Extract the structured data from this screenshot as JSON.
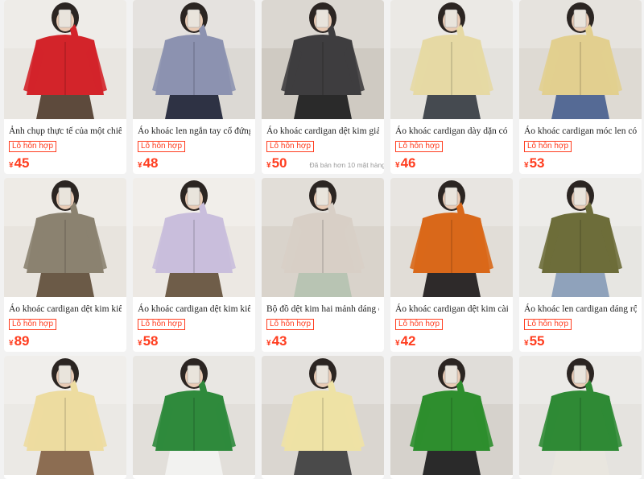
{
  "products": [
    {
      "title": "Ảnh chụp thực tế của một chiếc áo",
      "badge": "Lô hỗn hợp",
      "currency": "¥",
      "price": "45",
      "sold": "",
      "colors": {
        "bg": "#e9e6e1",
        "garment": "#d3242a",
        "pants": "#5d4a3c"
      }
    },
    {
      "title": "Áo khoác len ngắn tay cổ đứng, khóa",
      "badge": "Lô hỗn hợp",
      "currency": "¥",
      "price": "48",
      "sold": "",
      "colors": {
        "bg": "#dcd9d4",
        "garment": "#8c92b0",
        "pants": "#2e3244"
      }
    },
    {
      "title": "Áo khoác cardigan dệt kim giả lông",
      "badge": "Lô hỗn hợp",
      "currency": "¥",
      "price": "50",
      "sold": "Đã bán hơn 10 mặt hàng.",
      "colors": {
        "bg": "#cfcac2",
        "garment": "#3e3d3f",
        "pants": "#2a2a2a"
      }
    },
    {
      "title": "Áo khoác cardigan dày dặn có mũ,",
      "badge": "Lô hỗn hợp",
      "currency": "¥",
      "price": "46",
      "sold": "",
      "colors": {
        "bg": "#e4e2dd",
        "garment": "#e6d9a4",
        "pants": "#454a50"
      }
    },
    {
      "title": "Áo khoác cardigan móc len có mũ",
      "badge": "Lô hỗn hợp",
      "currency": "¥",
      "price": "53",
      "sold": "",
      "colors": {
        "bg": "#dedad3",
        "garment": "#e2cf8f",
        "pants": "#556a95"
      }
    },
    {
      "title": "Áo khoác cardigan dệt kim kiểu Anh,",
      "badge": "Lô hỗn hợp",
      "currency": "¥",
      "price": "89",
      "sold": "",
      "colors": {
        "bg": "#e8e4de",
        "garment": "#8b8270",
        "pants": "#6b5a47"
      }
    },
    {
      "title": "Áo khoác cardigan dệt kim kiểu cáp",
      "badge": "Lô hỗn hợp",
      "currency": "¥",
      "price": "58",
      "sold": "",
      "colors": {
        "bg": "#ece8e3",
        "garment": "#c9bedc",
        "pants": "#6f5d49"
      }
    },
    {
      "title": "Bộ đồ dệt kim hai mảnh dáng ôm",
      "badge": "Lô hỗn hợp",
      "currency": "¥",
      "price": "43",
      "sold": "",
      "colors": {
        "bg": "#d9d3cb",
        "garment": "#d8cfc6",
        "pants": "#b8c4b3"
      }
    },
    {
      "title": "Áo khoác cardigan dệt kim cài khuy",
      "badge": "Lô hỗn hợp",
      "currency": "¥",
      "price": "42",
      "sold": "",
      "colors": {
        "bg": "#e1ddd7",
        "garment": "#d9681a",
        "pants": "#2e2a2a"
      }
    },
    {
      "title": "Áo khoác len cardigan dáng rộng",
      "badge": "Lô hỗn hợp",
      "currency": "¥",
      "price": "55",
      "sold": "",
      "colors": {
        "bg": "#e7e6e2",
        "garment": "#6d6d3a",
        "pants": "#8fa2bb"
      }
    },
    {
      "title": "",
      "badge": "",
      "currency": "",
      "price": "",
      "sold": "",
      "colors": {
        "bg": "#ebe9e5",
        "garment": "#eddca0",
        "pants": "#8c6d52"
      }
    },
    {
      "title": "",
      "badge": "",
      "currency": "",
      "price": "",
      "sold": "",
      "colors": {
        "bg": "#e2dfda",
        "garment": "#2f8a3c",
        "pants": "#f2f2f0"
      }
    },
    {
      "title": "",
      "badge": "",
      "currency": "",
      "price": "",
      "sold": "",
      "colors": {
        "bg": "#dad6d0",
        "garment": "#eee2a5",
        "pants": "#4a4a4a"
      }
    },
    {
      "title": "",
      "badge": "",
      "currency": "",
      "price": "",
      "sold": "",
      "colors": {
        "bg": "#d6d2cc",
        "garment": "#2e8e2e",
        "pants": "#2a2a2a"
      }
    },
    {
      "title": "",
      "badge": "",
      "currency": "",
      "price": "",
      "sold": "",
      "colors": {
        "bg": "#e5e3df",
        "garment": "#2f8a35",
        "pants": "#e9e6df"
      }
    }
  ]
}
